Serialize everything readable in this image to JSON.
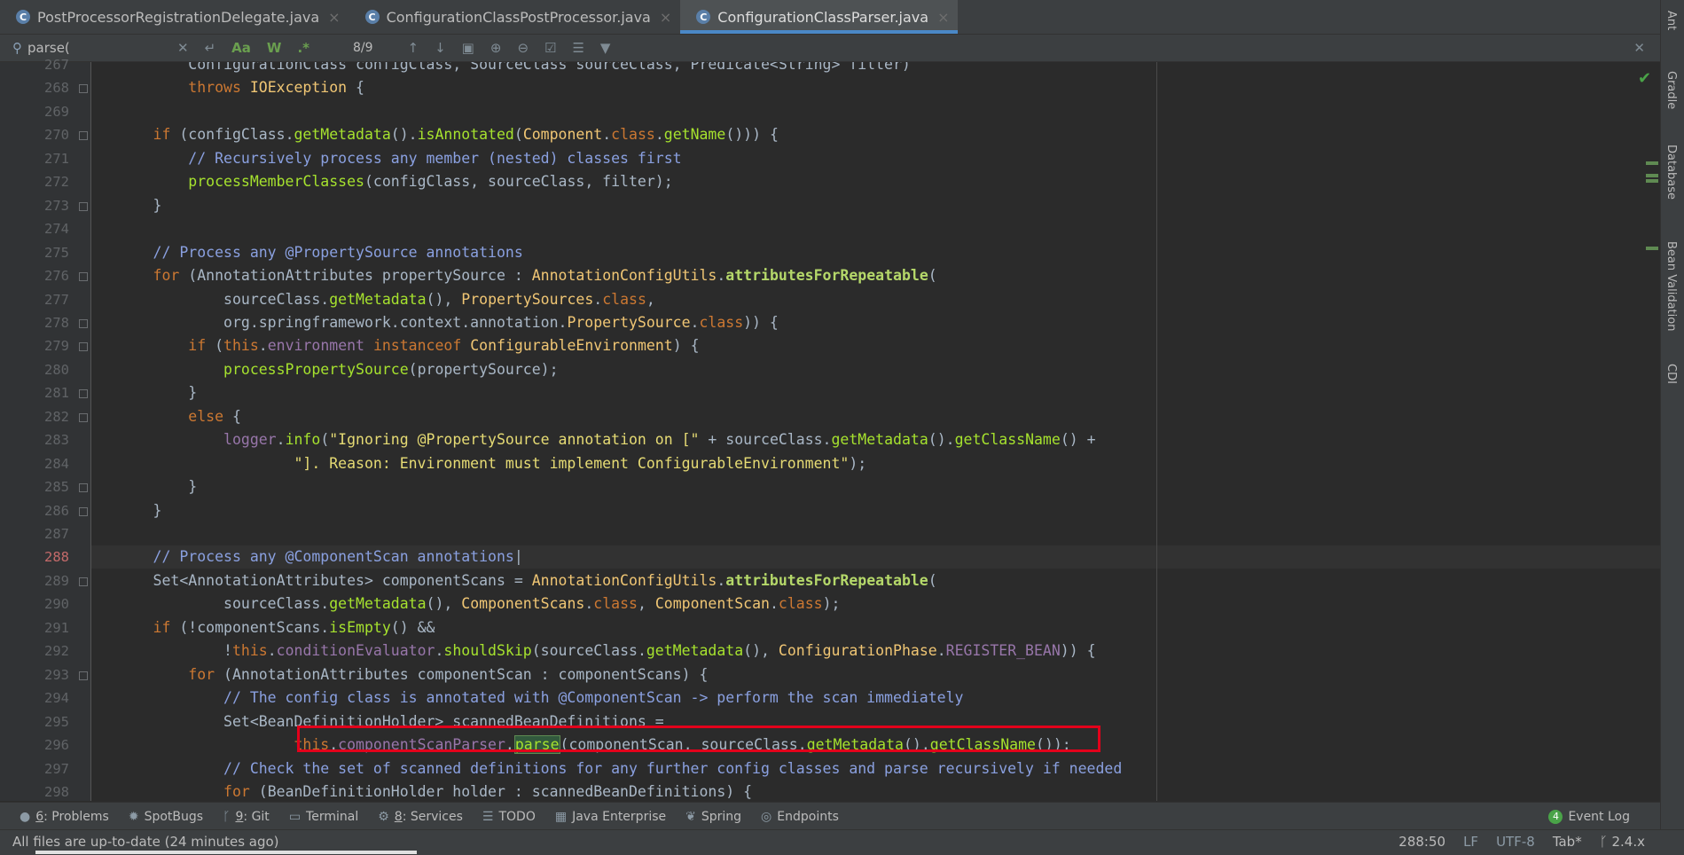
{
  "tabs": [
    {
      "label": "PostProcessorRegistrationDelegate.java",
      "active": false
    },
    {
      "label": "ConfigurationClassPostProcessor.java",
      "active": false
    },
    {
      "label": "ConfigurationClassParser.java",
      "active": true
    }
  ],
  "search": {
    "query": "parse(",
    "match_counter": "8/9",
    "case_label": "Aa",
    "word_label": "W",
    "regex_label": ".*"
  },
  "editor": {
    "lines": [
      {
        "n": "267",
        "html": "        <span class='t'>ConfigurationClass configClass, SourceClass sourceClass, Predicate&lt;String&gt; filter)</span>"
      },
      {
        "n": "268",
        "html": "        <span class='k'>throws</span> <span class='cls'>IOException</span> <span class='t'>{</span>"
      },
      {
        "n": "269",
        "html": ""
      },
      {
        "n": "270",
        "html": "    <span class='k'>if</span> <span class='t'>(configClass.</span><span class='fg'>getMetadata</span><span class='t'>().</span><span class='fg'>isAnnotated</span><span class='t'>(</span><span class='cls'>Component</span><span class='t'>.</span><span class='k'>class</span><span class='t'>.</span><span class='fg'>getName</span><span class='t'>())) {</span>"
      },
      {
        "n": "271",
        "html": "        <span class='cm'>// Recursively process any member (nested) classes first</span>"
      },
      {
        "n": "272",
        "html": "        <span class='fg'>processMemberClasses</span><span class='t'>(configClass, sourceClass, filter);</span>"
      },
      {
        "n": "273",
        "html": "    <span class='t'>}</span>"
      },
      {
        "n": "274",
        "html": ""
      },
      {
        "n": "275",
        "html": "    <span class='cm'>// Process any @PropertySource annotations</span>"
      },
      {
        "n": "276",
        "html": "    <span class='k'>for</span> <span class='t'>(AnnotationAttributes propertySource : </span><span class='cls'>AnnotationConfigUtils</span><span class='t'>.</span><span class='fb'>attributesForRepeatable</span><span class='t'>(</span>"
      },
      {
        "n": "277",
        "html": "            <span class='t'>sourceClass.</span><span class='fg'>getMetadata</span><span class='t'>(), </span><span class='cls'>PropertySources</span><span class='t'>.</span><span class='k'>class</span><span class='t'>,</span>"
      },
      {
        "n": "278",
        "html": "            <span class='t'>org.springframework.context.annotation.</span><span class='cls'>PropertySource</span><span class='t'>.</span><span class='k'>class</span><span class='t'>)) {</span>"
      },
      {
        "n": "279",
        "html": "        <span class='k'>if</span> <span class='t'>(</span><span class='k'>this</span><span class='t'>.</span><span class='pf'>environment</span> <span class='k'>instanceof</span> <span class='cls'>ConfigurableEnvironment</span><span class='t'>) {</span>"
      },
      {
        "n": "280",
        "html": "            <span class='fg'>processPropertySource</span><span class='t'>(propertySource);</span>"
      },
      {
        "n": "281",
        "html": "        <span class='t'>}</span>"
      },
      {
        "n": "282",
        "html": "        <span class='k'>else</span> <span class='t'>{</span>"
      },
      {
        "n": "283",
        "html": "            <span class='pf'>logger</span><span class='t'>.</span><span class='fg'>info</span><span class='t'>(</span><span class='st'>\"Ignoring @PropertySource annotation on [\"</span> <span class='t'>+ sourceClass.</span><span class='fg'>getMetadata</span><span class='t'>().</span><span class='fg'>getClassName</span><span class='t'>() +</span>"
      },
      {
        "n": "284",
        "html": "                    <span class='st'>\"]. Reason: Environment must implement ConfigurableEnvironment\"</span><span class='t'>);</span>"
      },
      {
        "n": "285",
        "html": "        <span class='t'>}</span>"
      },
      {
        "n": "286",
        "html": "    <span class='t'>}</span>"
      },
      {
        "n": "287",
        "html": ""
      },
      {
        "n": "288",
        "html": "    <span class='cm'>// Process any @ComponentScan annotations</span><span class='t'>|</span>",
        "current": true
      },
      {
        "n": "289",
        "html": "    <span class='t'>Set&lt;AnnotationAttributes&gt; componentScans = </span><span class='cls'>AnnotationConfigUtils</span><span class='t'>.</span><span class='fb'>attributesForRepeatable</span><span class='t'>(</span>"
      },
      {
        "n": "290",
        "html": "            <span class='t'>sourceClass.</span><span class='fg'>getMetadata</span><span class='t'>(), </span><span class='cls'>ComponentScans</span><span class='t'>.</span><span class='k'>class</span><span class='t'>, </span><span class='cls'>ComponentScan</span><span class='t'>.</span><span class='k'>class</span><span class='t'>);</span>"
      },
      {
        "n": "291",
        "html": "    <span class='k'>if</span> <span class='t'>(!componentScans.</span><span class='fg'>isEmpty</span><span class='t'>() &amp;&amp;</span>"
      },
      {
        "n": "292",
        "html": "            <span class='t'>!</span><span class='k'>this</span><span class='t'>.</span><span class='pf'>conditionEvaluator</span><span class='t'>.</span><span class='fg'>shouldSkip</span><span class='t'>(sourceClass.</span><span class='fg'>getMetadata</span><span class='t'>(), </span><span class='cls'>ConfigurationPhase</span><span class='t'>.</span><span class='pf'>REGISTER_BEAN</span><span class='t'>)) {</span>"
      },
      {
        "n": "293",
        "html": "        <span class='k'>for</span> <span class='t'>(AnnotationAttributes componentScan : componentScans) {</span>"
      },
      {
        "n": "294",
        "html": "            <span class='cm'>// The config class is annotated with @ComponentScan -&gt; perform the scan immediately</span>"
      },
      {
        "n": "295",
        "html": "            <span class='t'>Set&lt;BeanDefinitionHolder&gt; scannedBeanDefinitions =</span>"
      },
      {
        "n": "296",
        "html": "                    <span class='k'>this</span><span class='t'>.</span><span class='pf'>componentScanParser</span><span class='t'>.</span><span class='fg hl'>parse</span><span class='t'>(componentScan, sourceClass.</span><span class='fg'>getMetadata</span><span class='t'>().</span><span class='fg'>getClassName</span><span class='t'>());</span>"
      },
      {
        "n": "297",
        "html": "            <span class='cm'>// Check the set of scanned definitions for any further config classes and parse recursively if needed</span>"
      },
      {
        "n": "298",
        "html": "            <span class='k'>for</span> <span class='t'>(BeanDefinitionHolder holder : scannedBeanDefinitions) {</span>"
      }
    ]
  },
  "right_sidebar": [
    "Ant",
    "Gradle",
    "Database",
    "Bean Validation",
    "CDI"
  ],
  "tool_windows": [
    {
      "num": "6",
      "label": ": Problems",
      "icon": "problems-icon"
    },
    {
      "num": "",
      "label": "SpotBugs",
      "icon": "spotbugs-icon"
    },
    {
      "num": "9",
      "label": ": Git",
      "icon": "git-icon"
    },
    {
      "num": "",
      "label": "Terminal",
      "icon": "terminal-icon"
    },
    {
      "num": "8",
      "label": ": Services",
      "icon": "services-icon"
    },
    {
      "num": "",
      "label": "TODO",
      "icon": "todo-icon"
    },
    {
      "num": "",
      "label": "Java Enterprise",
      "icon": "java-enterprise-icon"
    },
    {
      "num": "",
      "label": "Spring",
      "icon": "spring-icon"
    },
    {
      "num": "",
      "label": "Endpoints",
      "icon": "endpoints-icon"
    }
  ],
  "event_log": {
    "count": "4",
    "label": "Event Log"
  },
  "status": {
    "message": "All files are up-to-date (24 minutes ago)",
    "position": "288:50",
    "line_ending": "LF",
    "encoding": "UTF-8",
    "indent": "Tab*",
    "branch": "2.4.x"
  },
  "colors": {
    "accent": "#4a88c7",
    "highlight_box": "#e3001b",
    "ok": "#4aa348"
  }
}
